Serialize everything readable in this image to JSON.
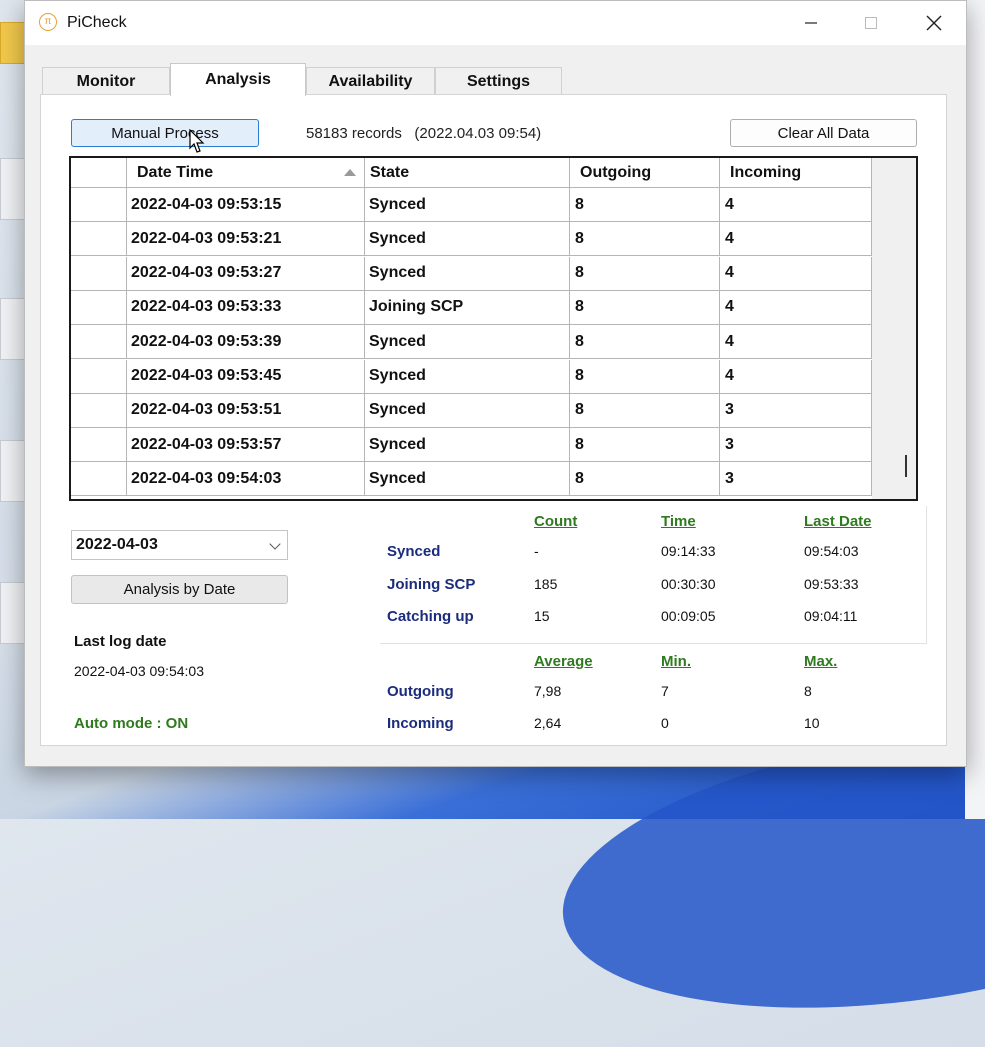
{
  "window": {
    "title": "PiCheck",
    "controls": {
      "minimize": "–",
      "maximize": "□",
      "close": "✕"
    }
  },
  "tabs": [
    {
      "label": "Monitor",
      "active": false
    },
    {
      "label": "Analysis",
      "active": true
    },
    {
      "label": "Availability",
      "active": false
    },
    {
      "label": "Settings",
      "active": false
    }
  ],
  "toolbar": {
    "manual_process_label": "Manual Process",
    "records_text": "58183 records   (2022.04.03 09:54)",
    "clear_all_label": "Clear All Data"
  },
  "grid": {
    "columns": [
      "Date Time",
      "State",
      "Outgoing",
      "Incoming"
    ],
    "sort_column": "Date Time",
    "rows": [
      {
        "datetime": "2022-04-03 09:53:15",
        "state": "Synced",
        "outgoing": "8",
        "incoming": "4"
      },
      {
        "datetime": "2022-04-03 09:53:21",
        "state": "Synced",
        "outgoing": "8",
        "incoming": "4"
      },
      {
        "datetime": "2022-04-03 09:53:27",
        "state": "Synced",
        "outgoing": "8",
        "incoming": "4"
      },
      {
        "datetime": "2022-04-03 09:53:33",
        "state": "Joining SCP",
        "outgoing": "8",
        "incoming": "4"
      },
      {
        "datetime": "2022-04-03 09:53:39",
        "state": "Synced",
        "outgoing": "8",
        "incoming": "4"
      },
      {
        "datetime": "2022-04-03 09:53:45",
        "state": "Synced",
        "outgoing": "8",
        "incoming": "4"
      },
      {
        "datetime": "2022-04-03 09:53:51",
        "state": "Synced",
        "outgoing": "8",
        "incoming": "3"
      },
      {
        "datetime": "2022-04-03 09:53:57",
        "state": "Synced",
        "outgoing": "8",
        "incoming": "3"
      },
      {
        "datetime": "2022-04-03 09:54:03",
        "state": "Synced",
        "outgoing": "8",
        "incoming": "3"
      }
    ]
  },
  "left": {
    "date_select": "2022-04-03",
    "analysis_button": "Analysis by Date",
    "last_log_label": "Last log date",
    "last_log_value": "2022-04-03 09:54:03",
    "auto_mode": "Auto mode : ON"
  },
  "stats": {
    "headers": {
      "count": "Count",
      "time": "Time",
      "last_date": "Last Date"
    },
    "states": [
      {
        "name": "Synced",
        "count": "-",
        "time": "09:14:33",
        "last_date": "09:54:03"
      },
      {
        "name": "Joining SCP",
        "count": "185",
        "time": "00:30:30",
        "last_date": "09:53:33"
      },
      {
        "name": "Catching up",
        "count": "15",
        "time": "00:09:05",
        "last_date": "09:04:11"
      }
    ],
    "peer_headers": {
      "average": "Average",
      "min": "Min.",
      "max": "Max."
    },
    "peers": [
      {
        "name": "Outgoing",
        "average": "7,98",
        "min": "7",
        "max": "8"
      },
      {
        "name": "Incoming",
        "average": "2,64",
        "min": "0",
        "max": "10"
      }
    ]
  },
  "colors": {
    "accent_green": "#2f7a1f",
    "navy_label": "#1b2c7c",
    "focus_blue": "#2b7cd3"
  }
}
